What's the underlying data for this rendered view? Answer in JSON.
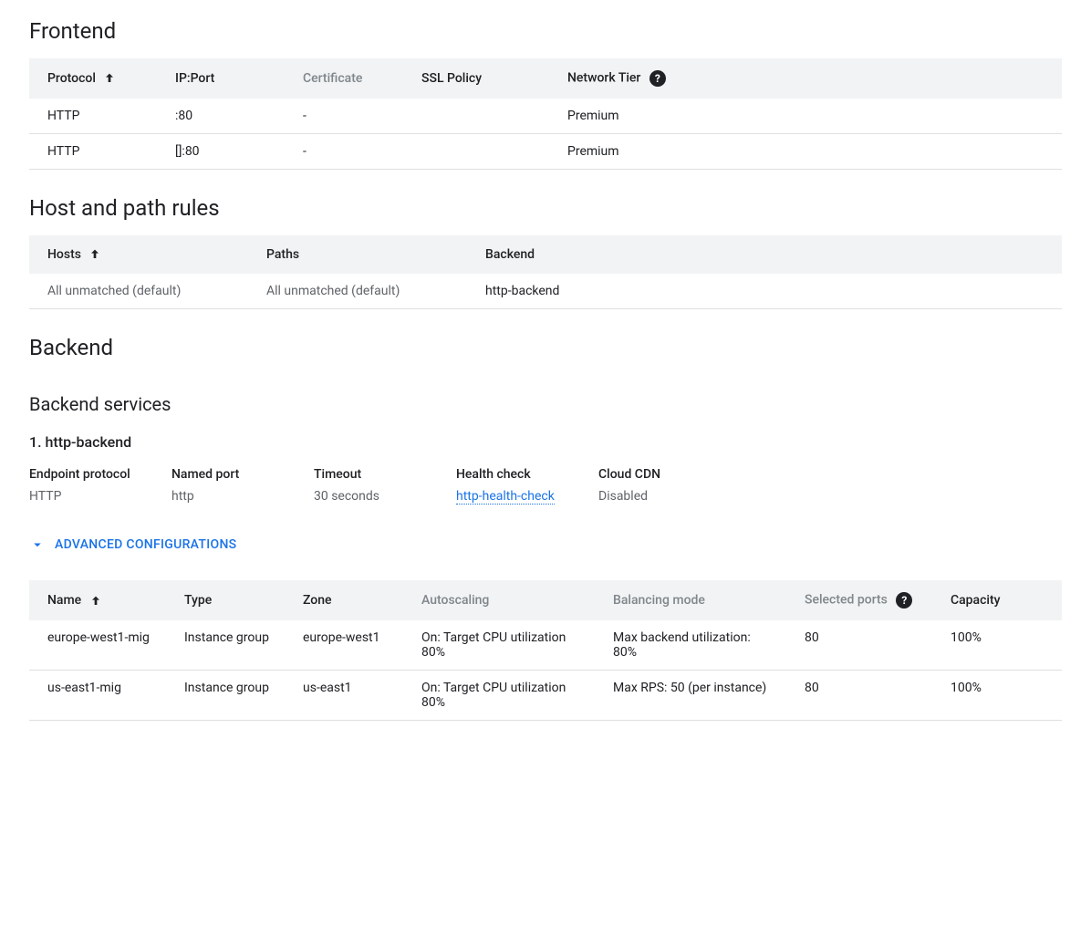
{
  "frontend": {
    "title": "Frontend",
    "columns": {
      "protocol": "Protocol",
      "ipport": "IP:Port",
      "certificate": "Certificate",
      "sslpolicy": "SSL Policy",
      "networktier": "Network Tier"
    },
    "rows": [
      {
        "protocol": "HTTP",
        "ipport": ":80",
        "certificate": "-",
        "sslpolicy": "",
        "networktier": "Premium"
      },
      {
        "protocol": "HTTP",
        "ipport": "[]:80",
        "certificate": "-",
        "sslpolicy": "",
        "networktier": "Premium"
      }
    ]
  },
  "hostpath": {
    "title": "Host and path rules",
    "columns": {
      "hosts": "Hosts",
      "paths": "Paths",
      "backend": "Backend"
    },
    "rows": [
      {
        "hosts": "All unmatched (default)",
        "paths": "All unmatched (default)",
        "backend": "http-backend"
      }
    ]
  },
  "backend": {
    "title": "Backend",
    "services_title": "Backend services",
    "service_label": "1. http-backend",
    "kv": {
      "endpoint_protocol_label": "Endpoint protocol",
      "endpoint_protocol_value": "HTTP",
      "named_port_label": "Named port",
      "named_port_value": "http",
      "timeout_label": "Timeout",
      "timeout_value": "30 seconds",
      "health_check_label": "Health check",
      "health_check_value": "http-health-check",
      "cloud_cdn_label": "Cloud CDN",
      "cloud_cdn_value": "Disabled"
    },
    "expander_label": "ADVANCED CONFIGURATIONS",
    "backends_table": {
      "columns": {
        "name": "Name",
        "type": "Type",
        "zone": "Zone",
        "autoscaling": "Autoscaling",
        "balancing": "Balancing mode",
        "ports": "Selected ports",
        "capacity": "Capacity"
      },
      "rows": [
        {
          "name": "europe-west1-mig",
          "type": "Instance group",
          "zone": "europe-west1",
          "autoscaling": "On: Target CPU utilization 80%",
          "balancing": "Max backend utilization: 80%",
          "ports": "80",
          "capacity": "100%"
        },
        {
          "name": "us-east1-mig",
          "type": "Instance group",
          "zone": "us-east1",
          "autoscaling": "On: Target CPU utilization 80%",
          "balancing": "Max RPS: 50 (per instance)",
          "ports": "80",
          "capacity": "100%"
        }
      ]
    }
  }
}
